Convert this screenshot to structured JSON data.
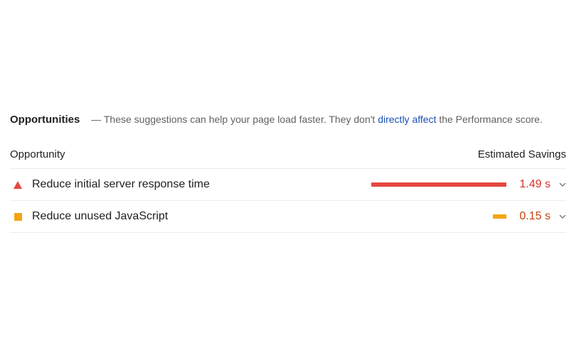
{
  "opportunities": {
    "title": "Opportunities",
    "description_prefix": "— These suggestions can help your page load faster. They don't",
    "link_text": "directly affect",
    "description_suffix": "the Performance score.",
    "col_opportunity": "Opportunity",
    "col_savings": "Estimated Savings",
    "items": [
      {
        "label": "Reduce initial server response time",
        "savings": "1.49 s",
        "savings_seconds": 1.49,
        "severity": "fail",
        "severity_icon": "warning-triangle-icon",
        "color": "#e5473f",
        "value_color": "#d93025"
      },
      {
        "label": "Reduce unused JavaScript",
        "savings": "0.15 s",
        "savings_seconds": 0.15,
        "severity": "average",
        "severity_icon": "orange-square-icon",
        "color": "#f4a413",
        "value_color": "#c5400f"
      }
    ]
  }
}
